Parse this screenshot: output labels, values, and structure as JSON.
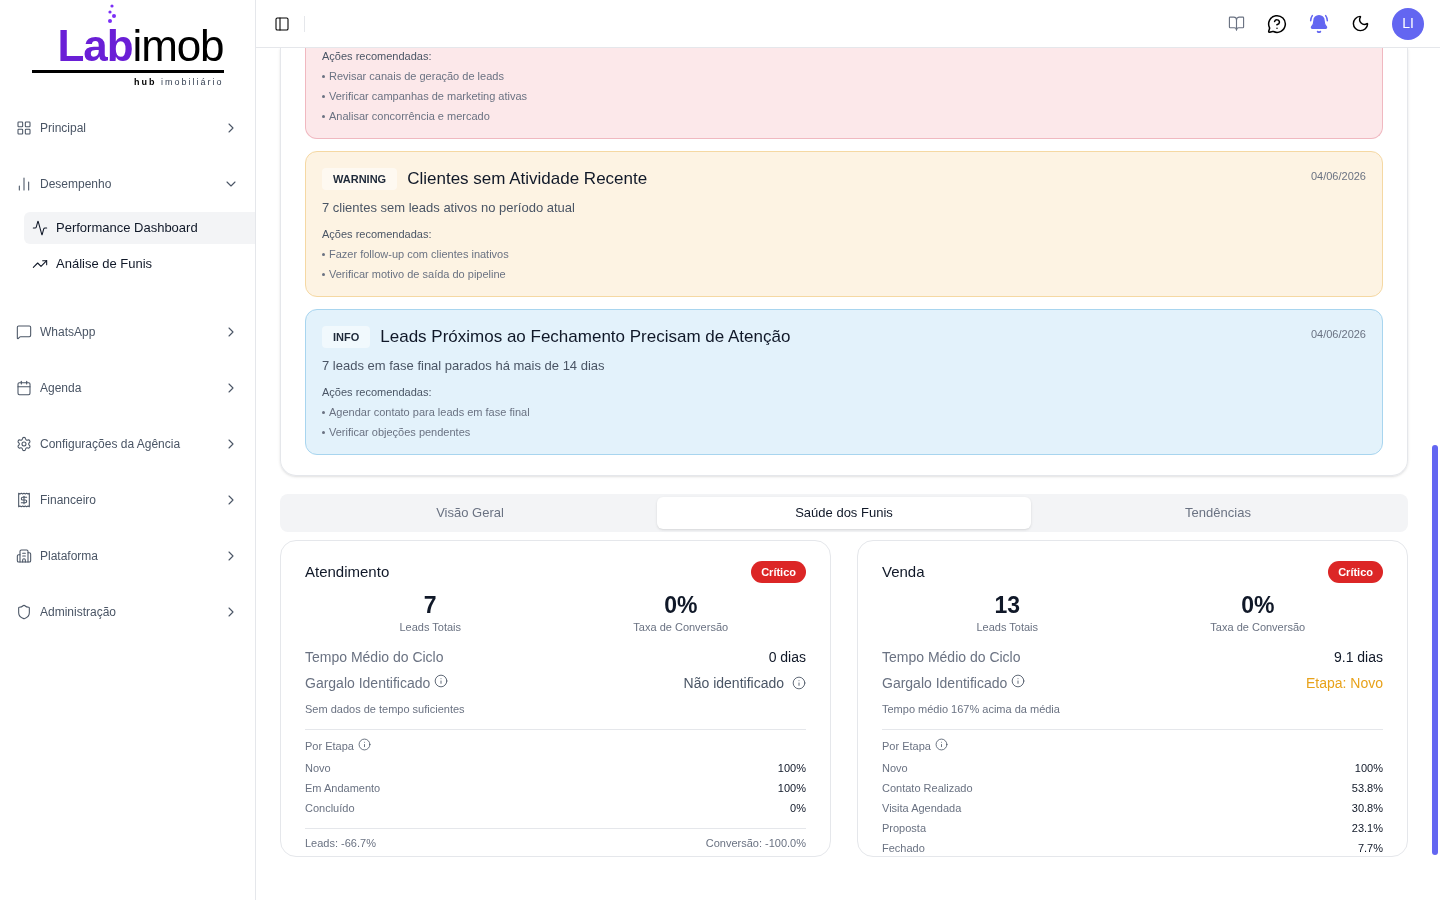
{
  "logo": {
    "brand_colored": "Lab",
    "brand_plain": "imob",
    "tagline_bold": "hub",
    "tagline": "imobiliário"
  },
  "sidebar": {
    "items": [
      {
        "label": "Principal",
        "expanded": false
      },
      {
        "label": "Desempenho",
        "expanded": true,
        "children": [
          {
            "label": "Performance Dashboard",
            "selected": true
          },
          {
            "label": "Análise de Funis",
            "selected": false
          }
        ]
      },
      {
        "label": "WhatsApp",
        "expanded": false
      },
      {
        "label": "Agenda",
        "expanded": false
      },
      {
        "label": "Configurações da Agência",
        "expanded": false
      },
      {
        "label": "Financeiro",
        "expanded": false
      },
      {
        "label": "Plataforma",
        "expanded": false
      },
      {
        "label": "Administração",
        "expanded": false
      }
    ]
  },
  "header": {
    "avatar": "LI"
  },
  "alerts": [
    {
      "kind": "critical",
      "actions_label": "Ações recomendadas:",
      "actions": [
        "Revisar canais de geração de leads",
        "Verificar campanhas de marketing ativas",
        "Analisar concorrência e mercado"
      ]
    },
    {
      "kind": "warning",
      "label": "WARNING",
      "title": "Clientes sem Atividade Recente",
      "date": "04/06/2026",
      "description": "7 clientes sem leads ativos no período atual",
      "actions_label": "Ações recomendadas:",
      "actions": [
        "Fazer follow-up com clientes inativos",
        "Verificar motivo de saída do pipeline"
      ]
    },
    {
      "kind": "info",
      "label": "INFO",
      "title": "Leads Próximos ao Fechamento Precisam de Atenção",
      "date": "04/06/2026",
      "description": "7 leads em fase final parados há mais de 14 dias",
      "actions_label": "Ações recomendadas:",
      "actions": [
        "Agendar contato para leads em fase final",
        "Verificar objeções pendentes"
      ]
    }
  ],
  "tabs": [
    {
      "label": "Visão Geral",
      "selected": false
    },
    {
      "label": "Saúde dos Funis",
      "selected": true
    },
    {
      "label": "Tendências",
      "selected": false
    }
  ],
  "funnels": [
    {
      "name": "Atendimento",
      "status": "Crítico",
      "leads_total": "7",
      "leads_label": "Leads Totais",
      "conversion": "0%",
      "conversion_label": "Taxa de Conversão",
      "cycle_label": "Tempo Médio do Ciclo",
      "cycle_value": "0 dias",
      "bottleneck_label": "Gargalo Identificado",
      "bottleneck_value": "Não identificado",
      "bottleneck_identified": false,
      "note": "Sem dados de tempo suficientes",
      "stages_label": "Por Etapa",
      "stages": [
        {
          "name": "Novo",
          "value": "100%"
        },
        {
          "name": "Em Andamento",
          "value": "100%"
        },
        {
          "name": "Concluído",
          "value": "0%"
        }
      ],
      "footer_left": "Leads: -66.7%",
      "footer_right": "Conversão: -100.0%"
    },
    {
      "name": "Venda",
      "status": "Crítico",
      "leads_total": "13",
      "leads_label": "Leads Totais",
      "conversion": "0%",
      "conversion_label": "Taxa de Conversão",
      "cycle_label": "Tempo Médio do Ciclo",
      "cycle_value": "9.1 dias",
      "bottleneck_label": "Gargalo Identificado",
      "bottleneck_value": "Etapa: Novo",
      "bottleneck_identified": true,
      "note": "Tempo médio 167% acima da média",
      "stages_label": "Por Etapa",
      "stages": [
        {
          "name": "Novo",
          "value": "100%"
        },
        {
          "name": "Contato Realizado",
          "value": "53.8%"
        },
        {
          "name": "Visita Agendada",
          "value": "30.8%"
        },
        {
          "name": "Proposta",
          "value": "23.1%"
        },
        {
          "name": "Fechado",
          "value": "7.7%"
        }
      ]
    }
  ]
}
